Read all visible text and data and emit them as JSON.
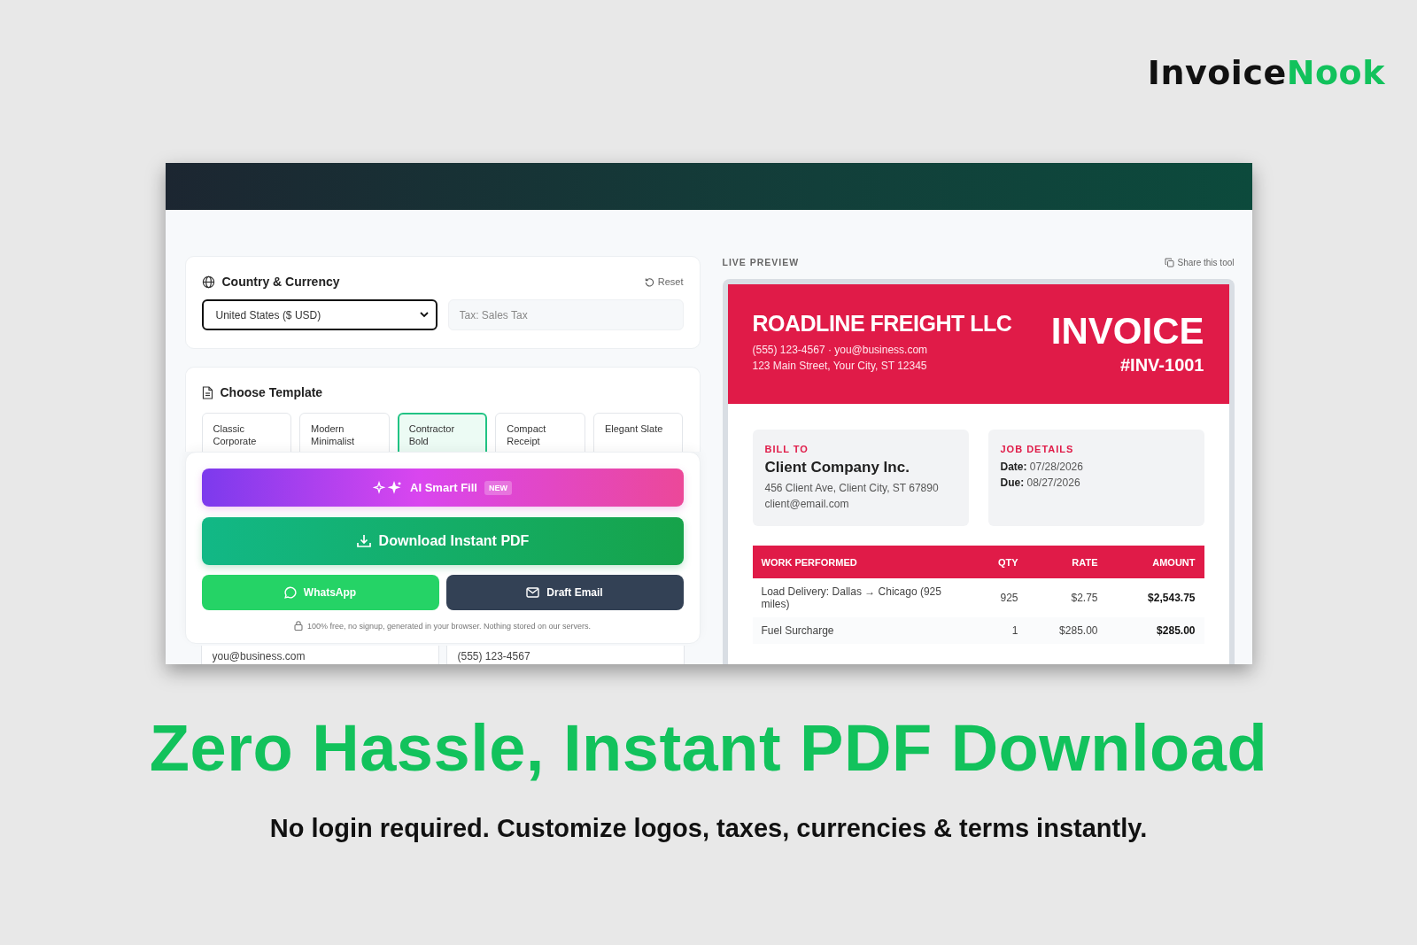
{
  "brand": {
    "first": "Invoice",
    "second": "Nook"
  },
  "app": {
    "currency_card": {
      "title": "Country & Currency",
      "reset": "Reset",
      "country_select": {
        "value": "United States ($ USD)"
      },
      "tax_field": {
        "placeholder": "Tax: Sales Tax"
      }
    },
    "template_card": {
      "title": "Choose Template",
      "templates": [
        {
          "label": "Classic Corporate",
          "selected": false
        },
        {
          "label": "Modern Minimalist",
          "selected": false
        },
        {
          "label": "Contractor Bold",
          "selected": true
        },
        {
          "label": "Compact Receipt",
          "selected": false
        },
        {
          "label": "Elegant Slate",
          "selected": false
        }
      ]
    },
    "actions": {
      "ai_button": {
        "label": "AI Smart Fill",
        "badge": "NEW"
      },
      "download_button": "Download Instant PDF",
      "whatsapp_button": "WhatsApp",
      "email_button": "Draft Email",
      "note": "100% free, no signup, generated in your browser. Nothing stored on our servers."
    },
    "fields": [
      {
        "value": "you@business.com"
      },
      {
        "value": "(555) 123-4567"
      }
    ],
    "preview": {
      "label": "LIVE PREVIEW",
      "share": "Share this tool",
      "invoice": {
        "company": "ROADLINE FREIGHT LLC",
        "contact": "(555) 123-4567 · you@business.com",
        "address": "123 Main Street, Your City, ST 12345",
        "title": "INVOICE",
        "number": "#INV-1001",
        "bill_to": {
          "heading": "BILL TO",
          "name": "Client Company Inc.",
          "address": "456 Client Ave, Client City, ST 67890",
          "email": "client@email.com"
        },
        "job_details": {
          "heading": "JOB DETAILS",
          "items": [
            {
              "label": "Date:",
              "value": "07/28/2026"
            },
            {
              "label": "Due:",
              "value": "08/27/2026"
            }
          ]
        },
        "table": {
          "columns": [
            "WORK PERFORMED",
            "QTY",
            "RATE",
            "AMOUNT"
          ],
          "rows": [
            [
              "Load Delivery: Dallas → Chicago (925 miles)",
              "925",
              "$2.75",
              "$2,543.75"
            ],
            [
              "Fuel Surcharge",
              "1",
              "$285.00",
              "$285.00"
            ]
          ]
        }
      }
    }
  },
  "headline": "Zero Hassle, Instant PDF Download",
  "subheadline": "No login required. Customize logos, taxes, currencies & terms instantly."
}
